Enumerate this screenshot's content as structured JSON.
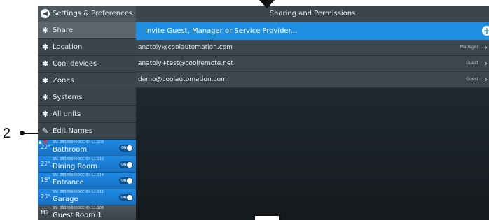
{
  "annotation": {
    "callout_number": "2"
  },
  "sidebar": {
    "items": [
      {
        "label": "Settings & Preferences",
        "icon": "back-arrow-icon"
      },
      {
        "label": "Share",
        "icon": "cross-tools-icon"
      },
      {
        "label": "Location",
        "icon": "cross-tools-icon"
      },
      {
        "label": "Cool devices",
        "icon": "cross-tools-icon"
      },
      {
        "label": "Zones",
        "icon": "cross-tools-icon"
      },
      {
        "label": "Systems",
        "icon": "cross-tools-icon"
      },
      {
        "label": "All units",
        "icon": "cross-tools-icon"
      },
      {
        "label": "Edit Names",
        "icon": "pencil-icon"
      }
    ]
  },
  "units": [
    {
      "temp": "22°",
      "meta": "SN: 283896000CC ID: L1.103",
      "name": "Bathroom",
      "toggle": "ON"
    },
    {
      "temp": "22°",
      "meta": "SN: 283896000CC ID: L1.110",
      "name": "Dining Room",
      "toggle": "ON"
    },
    {
      "temp": "19°",
      "meta": "SN: 283896000CC ID: L1.114",
      "name": "Entrance",
      "toggle": "ON"
    },
    {
      "temp": "23°",
      "meta": "SN: 283896000CC ID: L1.111",
      "name": "Garage",
      "toggle": "ON"
    },
    {
      "temp": "M2",
      "meta": "SN: 283896000CC ID: L1.108",
      "name": "Guest Room 1",
      "toggle": ""
    }
  ],
  "main": {
    "title": "Sharing and Permissions",
    "invite_label": "Invite Guest, Manager or Service Provider...",
    "users": [
      {
        "email": "anatoly@coolautomation.com",
        "role": "Manager"
      },
      {
        "email": "anatoly+test@coolremote.net",
        "role": "Guest"
      },
      {
        "email": "demo@coolautomation.com",
        "role": "Guest"
      }
    ]
  },
  "colors": {
    "accent_blue": "#1f8fe3",
    "sidebar_bg": "#3a454c",
    "alert_red": "#e0303a"
  }
}
